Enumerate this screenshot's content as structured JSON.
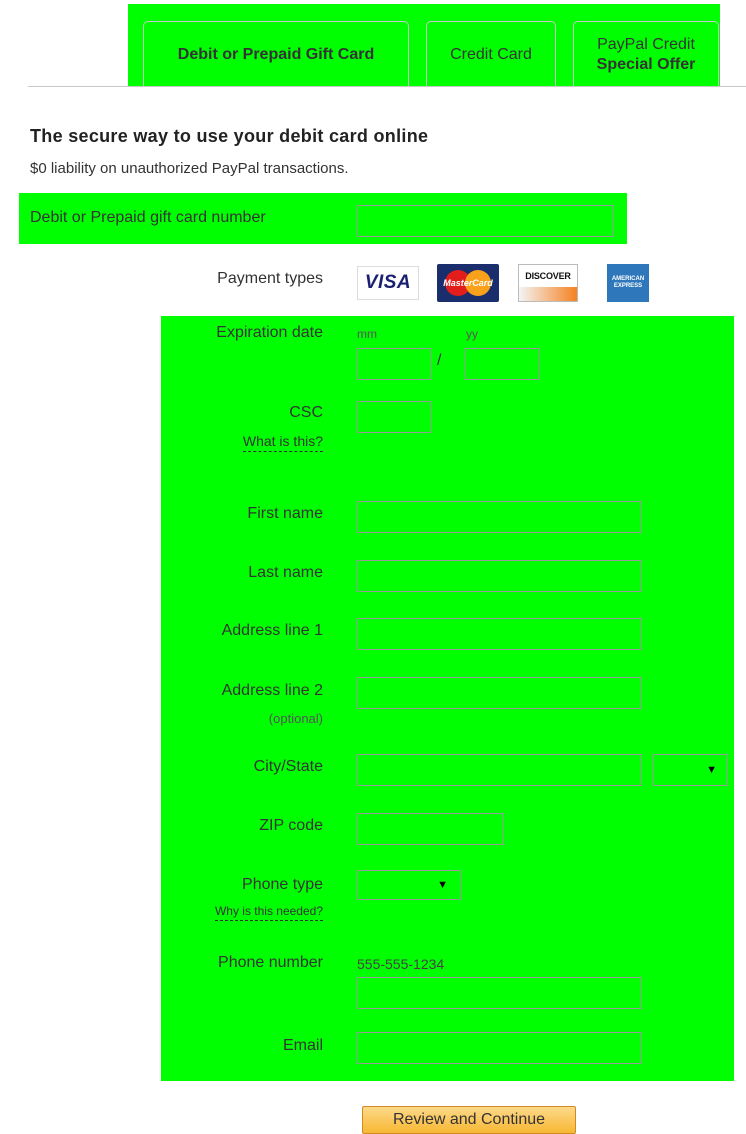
{
  "tabs": [
    {
      "label": "Debit or Prepaid Gift Card",
      "active": true
    },
    {
      "label": "Credit Card",
      "active": false
    },
    {
      "line1": "PayPal Credit",
      "line2": "Special Offer",
      "active": false
    }
  ],
  "header": {
    "title": "The secure way to use your debit card online",
    "subtitle": "$0 liability on unauthorized PayPal transactions."
  },
  "form": {
    "card_number_label": "Debit or Prepaid gift card number",
    "card_number_value": "",
    "payment_types_label": "Payment types",
    "payment_types": [
      {
        "name": "visa-logo",
        "text": "VISA"
      },
      {
        "name": "mastercard-logo",
        "text": "MasterCard"
      },
      {
        "name": "discover-logo",
        "text": "DISCOVER"
      },
      {
        "name": "amex-logo",
        "text": "AMERICAN EXPRESS"
      }
    ],
    "expiration_label": "Expiration date",
    "exp_month_hint": "mm",
    "exp_year_hint": "yy",
    "exp_separator": "/",
    "csc_label": "CSC",
    "csc_help": "What is this?",
    "first_name_label": "First name",
    "last_name_label": "Last name",
    "address1_label": "Address line 1",
    "address2_label": "Address line 2",
    "address2_hint": "(optional)",
    "city_state_label": "City/State",
    "zip_label": "ZIP code",
    "phone_type_label": "Phone type",
    "phone_type_help": "Why is this needed?",
    "phone_number_label": "Phone number",
    "phone_number_hint": "555-555-1234",
    "email_label": "Email",
    "dropdown_arrow": "▼"
  },
  "actions": {
    "review_continue": "Review and Continue"
  },
  "colors": {
    "highlight": "#00ff00",
    "button": "#f7b732"
  }
}
